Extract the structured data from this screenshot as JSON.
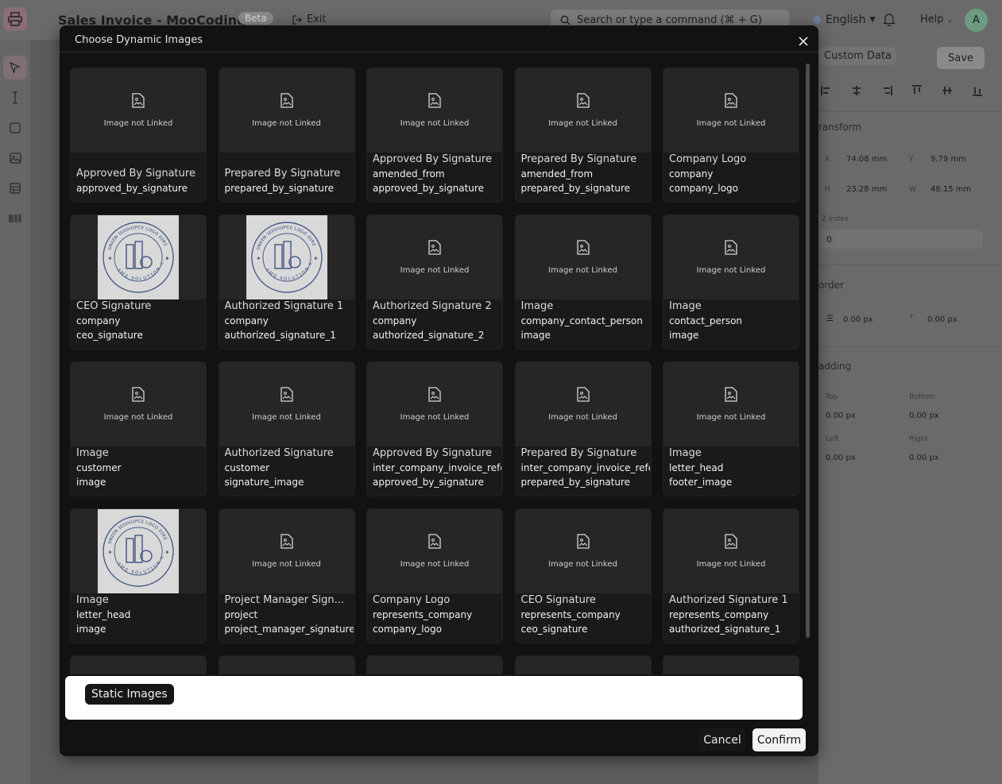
{
  "app": {
    "title": "Sales Invoice - MooCoding2",
    "beta": "Beta",
    "exit": "Exit",
    "search_placeholder": "Search or type a command (⌘ + G)",
    "language": "English",
    "help": "Help",
    "avatar_initial": "A"
  },
  "right_panel": {
    "tab": "Custom Data",
    "save": "Save",
    "transform": "ransform",
    "x_label": "X",
    "x": "74.08 mm",
    "y_label": "Y",
    "y": "9.79 mm",
    "h_label": "H",
    "h": "23.28 mm",
    "w_label": "W",
    "w": "48.15 mm",
    "z_index_label": "Z Index",
    "z_index": "0",
    "border": "order",
    "border_width": "0.00 px",
    "border_radius": "0.00 px",
    "padding": "adding",
    "top_label": "Top",
    "top": "0.00 px",
    "bottom_label": "Bottom",
    "bottom": "0.00 px",
    "left_label": "Left",
    "left": "0.00 px",
    "right_label": "Right",
    "right": "0.00 px"
  },
  "modal": {
    "title": "Choose Dynamic Images",
    "not_linked": "Image not Linked",
    "static_images": "Static Images",
    "cancel": "Cancel",
    "confirm": "Confirm",
    "cards": [
      {
        "title": "Approved By Signature",
        "lines": [
          "approved_by_signature"
        ],
        "stamp": false
      },
      {
        "title": "Prepared By Signature",
        "lines": [
          "prepared_by_signature"
        ],
        "stamp": false
      },
      {
        "title": "Approved By Signature",
        "lines": [
          "amended_from",
          "approved_by_signature"
        ],
        "stamp": false
      },
      {
        "title": "Prepared By Signature",
        "lines": [
          "amended_from",
          "prepared_by_signature"
        ],
        "stamp": false
      },
      {
        "title": "Company Logo",
        "lines": [
          "company",
          "company_logo"
        ],
        "stamp": false
      },
      {
        "title": "CEO Signature",
        "lines": [
          "company",
          "ceo_signature"
        ],
        "stamp": true
      },
      {
        "title": "Authorized Signature 1",
        "lines": [
          "company",
          "authorized_signature_1"
        ],
        "stamp": true
      },
      {
        "title": "Authorized Signature 2",
        "lines": [
          "company",
          "authorized_signature_2"
        ],
        "stamp": false
      },
      {
        "title": "Image",
        "lines": [
          "company_contact_person",
          "image"
        ],
        "stamp": false
      },
      {
        "title": "Image",
        "lines": [
          "contact_person",
          "image"
        ],
        "stamp": false
      },
      {
        "title": "Image",
        "lines": [
          "customer",
          "image"
        ],
        "stamp": false
      },
      {
        "title": "Authorized Signature",
        "lines": [
          "customer",
          "signature_image"
        ],
        "stamp": false
      },
      {
        "title": "Approved By Signature",
        "lines": [
          "inter_company_invoice_reference",
          "approved_by_signature"
        ],
        "stamp": false
      },
      {
        "title": "Prepared By Signature",
        "lines": [
          "inter_company_invoice_reference",
          "prepared_by_signature"
        ],
        "stamp": false
      },
      {
        "title": "Image",
        "lines": [
          "letter_head",
          "footer_image"
        ],
        "stamp": false
      },
      {
        "title": "Image",
        "lines": [
          "letter_head",
          "image"
        ],
        "stamp": true
      },
      {
        "title": "Project Manager Sign...",
        "lines": [
          "project",
          "project_manager_signature"
        ],
        "stamp": false
      },
      {
        "title": "Company Logo",
        "lines": [
          "represents_company",
          "company_logo"
        ],
        "stamp": false
      },
      {
        "title": "CEO Signature",
        "lines": [
          "represents_company",
          "ceo_signature"
        ],
        "stamp": false
      },
      {
        "title": "Authorized Signature 1",
        "lines": [
          "represents_company",
          "authorized_signature_1"
        ],
        "stamp": false
      },
      {
        "title": "",
        "lines": [],
        "stamp": false
      },
      {
        "title": "",
        "lines": [],
        "stamp": false
      },
      {
        "title": "",
        "lines": [],
        "stamp": false
      },
      {
        "title": "",
        "lines": [],
        "stamp": false
      },
      {
        "title": "",
        "lines": [],
        "stamp": false
      }
    ]
  },
  "stamp_text": {
    "top": "ᴜɴᴇᴇɴ ɪᴇᴅᴅᴜɪᴘᴄᴇ ʟᴏɢᴏ ᴅɪʀᴇ",
    "bottom": "ᴇᴍs sᴏʟᴜᴛɪᴏɴ ʟᴛᴅ"
  }
}
